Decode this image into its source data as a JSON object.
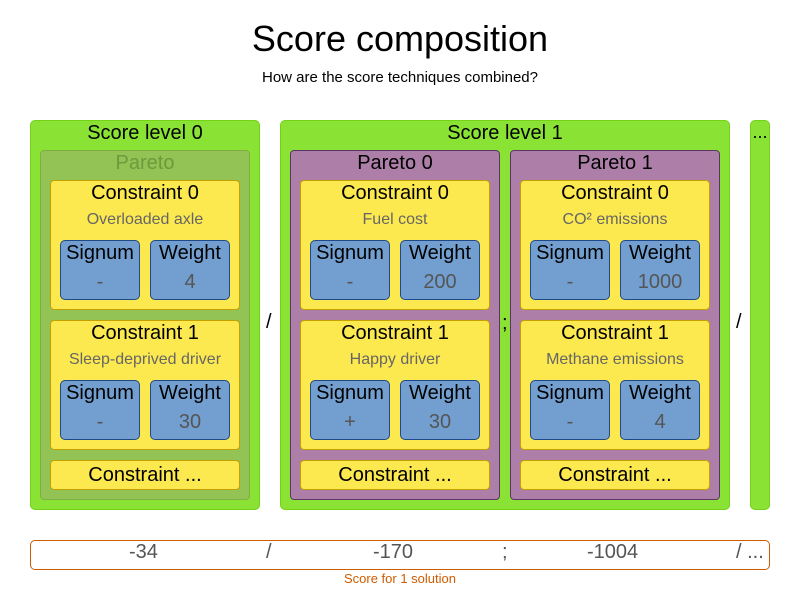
{
  "title": "Score composition",
  "subtitle": "How are the score techniques combined?",
  "labels": {
    "signum": "Signum",
    "weight": "Weight",
    "constraint_more": "Constraint ..."
  },
  "levels": [
    {
      "title": "Score level 0",
      "paretos": [
        {
          "title": "Pareto",
          "constraints": [
            {
              "title": "Constraint 0",
              "description": "Overloaded axle",
              "signum": "-",
              "weight": "4"
            },
            {
              "title": "Constraint 1",
              "description": "Sleep-deprived driver",
              "signum": "-",
              "weight": "30"
            }
          ]
        }
      ]
    },
    {
      "title": "Score level 1",
      "paretos": [
        {
          "title": "Pareto 0",
          "constraints": [
            {
              "title": "Constraint 0",
              "description": "Fuel cost",
              "signum": "-",
              "weight": "200"
            },
            {
              "title": "Constraint 1",
              "description": "Happy driver",
              "signum": "+",
              "weight": "30"
            }
          ]
        },
        {
          "title": "Pareto 1",
          "constraints": [
            {
              "title": "Constraint 0",
              "description": "CO² emissions",
              "signum": "-",
              "weight": "1000"
            },
            {
              "title": "Constraint 1",
              "description": "Methane emissions",
              "signum": "-",
              "weight": "4"
            }
          ]
        }
      ]
    },
    {
      "title": "..."
    }
  ],
  "separators": {
    "level": "/",
    "pareto": ";"
  },
  "score": {
    "values": [
      "-34",
      "-170",
      "-1004"
    ],
    "separators": [
      "/",
      ";",
      "/ ..."
    ],
    "caption": "Score for 1 solution"
  },
  "colors": {
    "level": "#8ae234",
    "pareto_single": "#93c255",
    "pareto": "#ad7fa8",
    "constraint": "#fce94f",
    "parameter": "#729fcf",
    "score_border": "#ce5c00"
  }
}
